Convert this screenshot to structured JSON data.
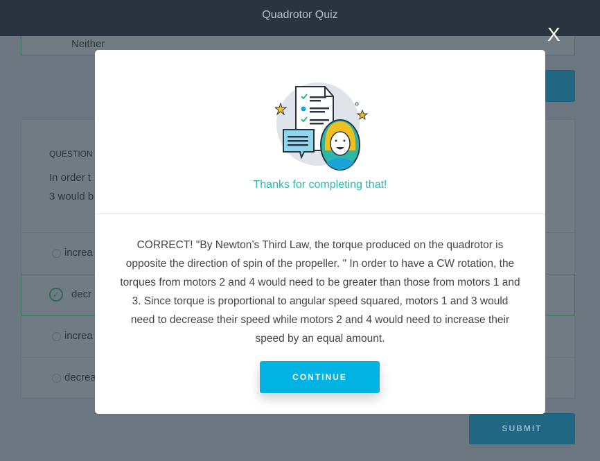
{
  "header": {
    "title": "Quadrotor Quiz"
  },
  "previous_question": {
    "selected_option": "Neither"
  },
  "question": {
    "label": "QUESTION",
    "text_line1": "In order t",
    "text_line2": "3 would b",
    "options": [
      {
        "label": "increa",
        "selected": false
      },
      {
        "label": "decr",
        "selected": true
      },
      {
        "label": "increa",
        "selected": false
      },
      {
        "label": "decrea",
        "selected": false
      }
    ],
    "submit_label": "SUBMIT"
  },
  "modal": {
    "close_label": "X",
    "title": "Thanks for completing that!",
    "message": "CORRECT! \"By Newton’s Third Law, the torque produced on the quadrotor is opposite the direction of spin of the propeller. \" In order to have a CW rotation, the torques from motors 2 and 4 would need to be greater than those from motors 1 and 3. Since torque is proportional to angular speed squared, motors 1 and 3 would need to decrease their speed while motors 2 and 4 would need to increase their speed by an equal amount.",
    "continue_label": "CONTINUE"
  },
  "colors": {
    "accent": "#00b3e3",
    "success": "#3a9a6a",
    "title": "#2bb8a8",
    "header": "#2a3440"
  }
}
